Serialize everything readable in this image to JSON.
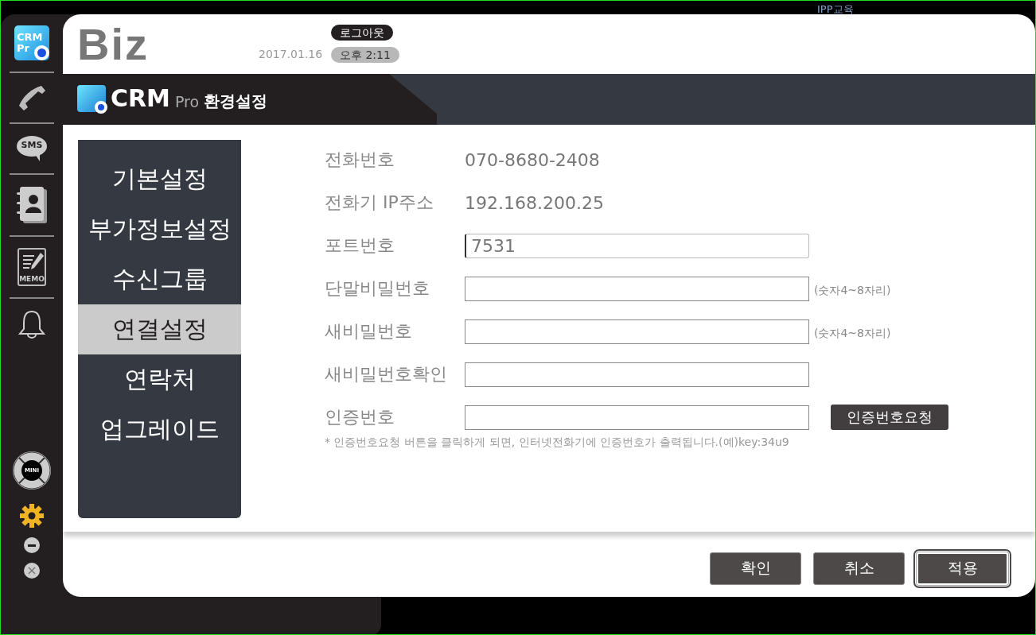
{
  "desktop_label": "IPP교육",
  "sidebar": {
    "logo_lines": [
      "CRM",
      "Pr"
    ],
    "sms_label": "SMS",
    "memo_label": "MEMO",
    "mini_label": "MINI"
  },
  "header": {
    "brand": "Biz",
    "date": "2017.01.16",
    "logout": "로그아웃",
    "time": "오후 2:11"
  },
  "title_bar": {
    "product": "CRM",
    "edition": "Pro",
    "title": "환경설정"
  },
  "menu": [
    {
      "label": "기본설정",
      "selected": false
    },
    {
      "label": "부가정보설정",
      "selected": false
    },
    {
      "label": "수신그룹",
      "selected": false
    },
    {
      "label": "연결설정",
      "selected": true
    },
    {
      "label": "연락처",
      "selected": false
    },
    {
      "label": "업그레이드",
      "selected": false
    }
  ],
  "form": {
    "rows": [
      {
        "kind": "text",
        "label": "전화번호",
        "value": "070-8680-2408"
      },
      {
        "kind": "text",
        "label": "전화기 IP주소",
        "value": "192.168.200.25"
      },
      {
        "kind": "input",
        "label": "포트번호",
        "value": "7531",
        "focused": true
      },
      {
        "kind": "input",
        "label": "단말비밀번호",
        "note": "(숫자4~8자리)",
        "focused": false
      },
      {
        "kind": "input",
        "label": "새비밀번호",
        "note": "(숫자4~8자리)",
        "focused": false
      },
      {
        "kind": "input",
        "label": "새비밀번호확인",
        "focused": false
      },
      {
        "kind": "input",
        "label": "인증번호",
        "action": "인증번호요청",
        "focused": false
      }
    ],
    "hint": "* 인증번호요청 버튼을 클릭하게 되면, 인터넷전화기에 인증번호가 출력됩니다.(예)key:34u9"
  },
  "buttons": [
    {
      "label": "확인",
      "focused": false
    },
    {
      "label": "취소",
      "focused": false
    },
    {
      "label": "적용",
      "focused": true
    }
  ]
}
